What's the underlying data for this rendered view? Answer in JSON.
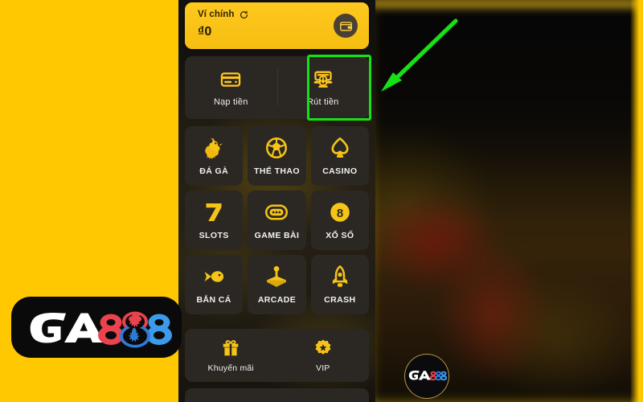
{
  "page": {
    "background_color": "#FFC800",
    "highlight_color": "#17E016",
    "accent_color": "#FFC81E",
    "panel_color": "#2b2824"
  },
  "wallet": {
    "label": "Ví chính",
    "refresh_icon": "refresh-icon",
    "amount": "₫0",
    "action_icon": "wallet-icon"
  },
  "money_actions": [
    {
      "label": "Nạp tiền",
      "icon": "deposit-card-icon",
      "highlighted": false
    },
    {
      "label": "Rút tiền",
      "icon": "withdraw-atm-icon",
      "highlighted": true
    }
  ],
  "games": [
    {
      "label": "ĐÁ GÀ",
      "icon": "rooster-icon"
    },
    {
      "label": "THỂ THAO",
      "icon": "soccer-ball-icon"
    },
    {
      "label": "CASINO",
      "icon": "spade-icon"
    },
    {
      "label": "SLOTS",
      "icon": "seven-icon"
    },
    {
      "label": "GAME BÀI",
      "icon": "card-table-icon"
    },
    {
      "label": "XỔ SỐ",
      "icon": "lottery-ball-8-icon"
    },
    {
      "label": "BẮN CÁ",
      "icon": "fish-icon"
    },
    {
      "label": "ARCADE",
      "icon": "joystick-icon"
    },
    {
      "label": "CRASH",
      "icon": "rocket-icon"
    }
  ],
  "promos": [
    {
      "label": "Khuyến mãi",
      "icon": "gift-icon"
    },
    {
      "label": "VIP",
      "icon": "vip-badge-icon"
    }
  ],
  "annotation": {
    "arrow": "green-arrow-pointing-to-withdraw",
    "arrow_color": "#17E016"
  },
  "branding": {
    "logo_text_left": "GA",
    "logo_text_right": "888",
    "watermark_text": "GA888",
    "logo_colors": {
      "ga": "#FFFFFF",
      "first_eight": "#E8434E",
      "middle_eight": "#2E7BD6",
      "last_eight": "#3B9BEA"
    }
  }
}
